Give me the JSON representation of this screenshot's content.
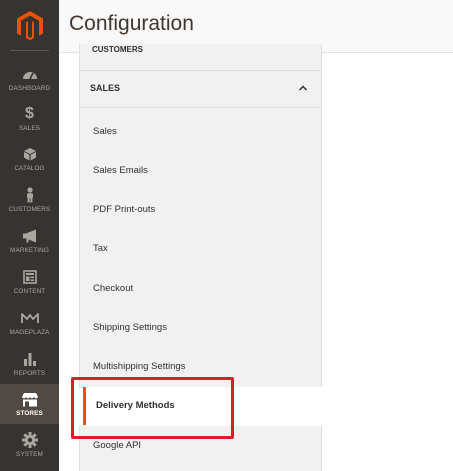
{
  "header": {
    "title": "Configuration"
  },
  "sidebar": {
    "items": [
      {
        "label": "DASHBOARD",
        "icon": "dashboard-icon"
      },
      {
        "label": "SALES",
        "icon": "dollar-icon"
      },
      {
        "label": "CATALOG",
        "icon": "catalog-box-icon"
      },
      {
        "label": "CUSTOMERS",
        "icon": "customer-person-icon"
      },
      {
        "label": "MARKETING",
        "icon": "megaphone-icon"
      },
      {
        "label": "CONTENT",
        "icon": "content-layout-icon"
      },
      {
        "label": "MAGEPLAZA",
        "icon": "mageplaza-logo-icon"
      },
      {
        "label": "REPORTS",
        "icon": "bar-chart-icon"
      },
      {
        "label": "STORES",
        "icon": "store-icon",
        "active": true
      },
      {
        "label": "SYSTEM",
        "icon": "gear-icon"
      }
    ]
  },
  "config": {
    "previous_group": "CUSTOMERS",
    "group": {
      "title": "SALES",
      "expanded": true
    },
    "tabs": [
      {
        "label": "Sales"
      },
      {
        "label": "Sales Emails"
      },
      {
        "label": "PDF Print-outs"
      },
      {
        "label": "Tax"
      },
      {
        "label": "Checkout"
      },
      {
        "label": "Shipping Settings"
      },
      {
        "label": "Multishipping Settings"
      },
      {
        "label": "Delivery Methods",
        "active": true
      },
      {
        "label": "Google API"
      }
    ]
  },
  "colors": {
    "sidebar_bg": "#373330",
    "accent": "#eb5202",
    "highlight": "#d6202a"
  }
}
